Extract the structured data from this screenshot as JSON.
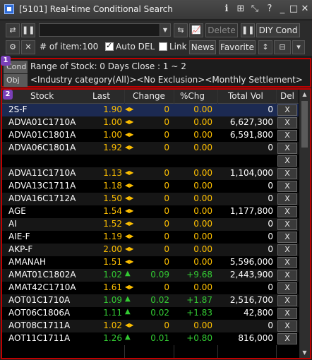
{
  "window": {
    "title": "[5101] Real-time Conditional Search"
  },
  "toolbar1": {
    "delete_label": "Delete",
    "diy_label": "DIY Cond",
    "condition_value": ""
  },
  "toolbar2": {
    "item_count": "# of item:100",
    "auto_del_label": "Auto DEL",
    "auto_del_checked": true,
    "link_label": "Link",
    "link_checked": false,
    "news_label": "News",
    "favorite_label": "Favorite"
  },
  "badges": {
    "section1": "1",
    "section2": "2"
  },
  "condition": {
    "cond_label": "Cond",
    "obj_label": "Obj",
    "cond_text": "Range of Stock: 0 Days Close : 1 ~ 2",
    "obj_text": "<Industry category(All)><No Exclusion><Monthly Settlement>"
  },
  "table": {
    "headers": [
      "Stock",
      "Last",
      "Change",
      "%Chg",
      "Total Vol",
      "Del"
    ],
    "delete_symbol": "X",
    "rows": [
      {
        "name": "2S-F",
        "last": "1.90",
        "change": "0",
        "pct": "0.00",
        "vol": "0",
        "dir": "flat",
        "selected": true
      },
      {
        "name": "ADVA01C1710A",
        "last": "1.00",
        "change": "0",
        "pct": "0.00",
        "vol": "6,627,300",
        "dir": "flat"
      },
      {
        "name": "ADVA01C1801A",
        "last": "1.00",
        "change": "0",
        "pct": "0.00",
        "vol": "6,591,800",
        "dir": "flat"
      },
      {
        "name": "ADVA06C1801A",
        "last": "1.92",
        "change": "0",
        "pct": "0.00",
        "vol": "0",
        "dir": "flat"
      },
      {
        "name": "",
        "last": "",
        "change": "",
        "pct": "",
        "vol": "",
        "dir": "none"
      },
      {
        "name": "ADVA11C1710A",
        "last": "1.13",
        "change": "0",
        "pct": "0.00",
        "vol": "1,104,000",
        "dir": "flat"
      },
      {
        "name": "ADVA13C1711A",
        "last": "1.18",
        "change": "0",
        "pct": "0.00",
        "vol": "0",
        "dir": "flat"
      },
      {
        "name": "ADVA16C1712A",
        "last": "1.50",
        "change": "0",
        "pct": "0.00",
        "vol": "0",
        "dir": "flat"
      },
      {
        "name": "AGE",
        "last": "1.54",
        "change": "0",
        "pct": "0.00",
        "vol": "1,177,800",
        "dir": "flat"
      },
      {
        "name": "AI",
        "last": "1.52",
        "change": "0",
        "pct": "0.00",
        "vol": "0",
        "dir": "flat"
      },
      {
        "name": "AIE-F",
        "last": "1.19",
        "change": "0",
        "pct": "0.00",
        "vol": "0",
        "dir": "flat"
      },
      {
        "name": "AKP-F",
        "last": "2.00",
        "change": "0",
        "pct": "0.00",
        "vol": "0",
        "dir": "flat"
      },
      {
        "name": "AMANAH",
        "last": "1.51",
        "change": "0",
        "pct": "0.00",
        "vol": "5,596,000",
        "dir": "flat"
      },
      {
        "name": "AMAT01C1802A",
        "last": "1.02",
        "change": "0.09",
        "pct": "+9.68",
        "vol": "2,443,900",
        "dir": "up"
      },
      {
        "name": "AMAT42C1710A",
        "last": "1.61",
        "change": "0",
        "pct": "0.00",
        "vol": "0",
        "dir": "flat"
      },
      {
        "name": "AOT01C1710A",
        "last": "1.09",
        "change": "0.02",
        "pct": "+1.87",
        "vol": "2,516,700",
        "dir": "up"
      },
      {
        "name": "AOT06C1806A",
        "last": "1.11",
        "change": "0.02",
        "pct": "+1.83",
        "vol": "42,800",
        "dir": "up"
      },
      {
        "name": "AOT08C1711A",
        "last": "1.02",
        "change": "0",
        "pct": "0.00",
        "vol": "0",
        "dir": "flat"
      },
      {
        "name": "AOT11C1711A",
        "last": "1.26",
        "change": "0.01",
        "pct": "+0.80",
        "vol": "816,000",
        "dir": "up"
      }
    ]
  },
  "colors": {
    "flat": "#ffc000",
    "up": "#33cc33",
    "selected_bg": "#1c2a52",
    "row_even": "#000000",
    "row_odd": "#161616",
    "border_red": "#c00000",
    "badge_purple": "#7a3fb8"
  }
}
